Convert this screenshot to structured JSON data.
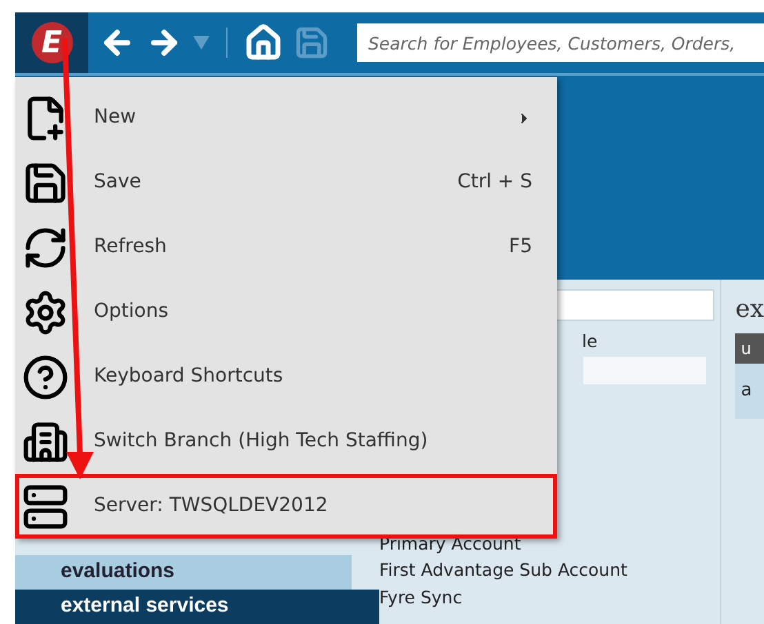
{
  "toolbar": {
    "logo_letter": "E",
    "history_dropdown": {
      "disabled": true
    },
    "save": {
      "disabled": true
    },
    "search": {
      "placeholder": "Search for Employees, Customers, Orders,"
    }
  },
  "menu": {
    "items": [
      {
        "kind": "new",
        "label": "New",
        "submenu": true,
        "highlighted": false
      },
      {
        "kind": "save",
        "label": "Save",
        "shortcut": "Ctrl + S",
        "highlighted": false
      },
      {
        "kind": "refresh",
        "label": "Refresh",
        "shortcut": "F5",
        "highlighted": false
      },
      {
        "kind": "options",
        "label": "Options",
        "highlighted": false
      },
      {
        "kind": "help",
        "label": "Keyboard Shortcuts",
        "highlighted": false
      },
      {
        "kind": "branch",
        "label": "Switch Branch (High Tech Staffing)",
        "highlighted": false
      },
      {
        "kind": "server",
        "label": "Server: TWSQLDEV2012",
        "highlighted": true
      }
    ]
  },
  "nav": {
    "items": [
      {
        "label": "evaluations",
        "selected": false
      },
      {
        "label": "external services",
        "selected": true
      }
    ]
  },
  "list": {
    "label_fragment": "le",
    "items": [
      "Primary Account",
      "First Advantage Sub Account",
      "Fyre Sync"
    ]
  },
  "right_panel": {
    "heading": "ex",
    "column_header": "u",
    "row": "a"
  }
}
